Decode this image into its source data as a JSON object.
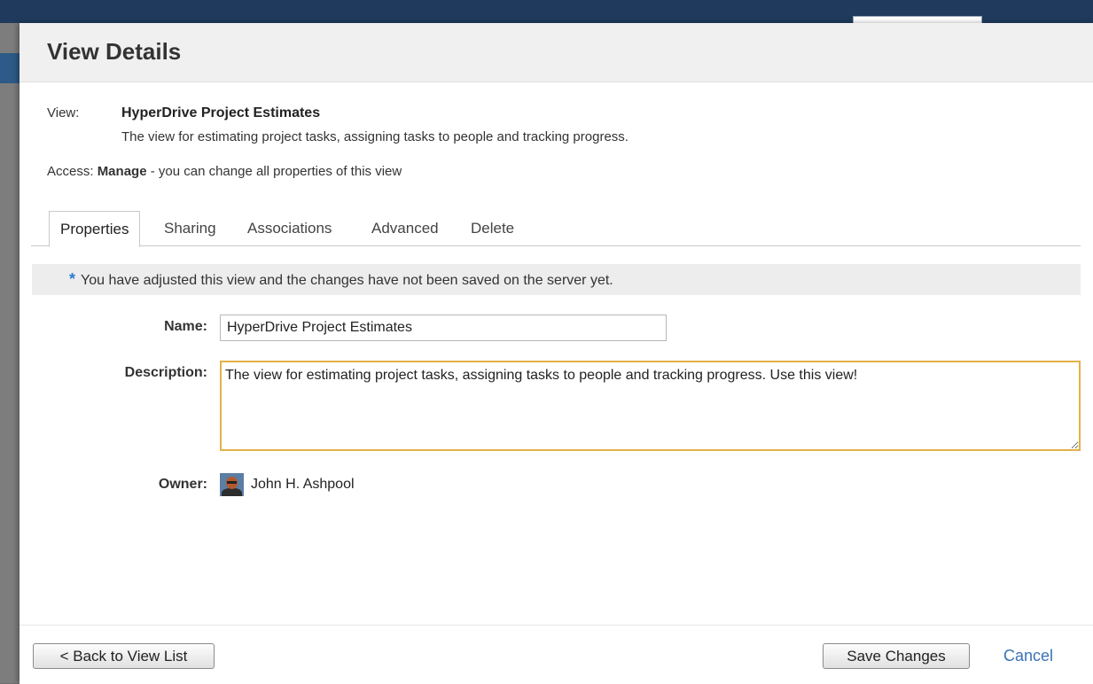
{
  "dialog": {
    "title": "View Details"
  },
  "view": {
    "label": "View:",
    "name": "HyperDrive Project Estimates",
    "description": "The view for estimating project tasks, assigning tasks to people and tracking progress."
  },
  "access": {
    "label": "Access:",
    "level": "Manage",
    "text": " - you can change all properties of this view"
  },
  "tabs": [
    {
      "label": "Properties",
      "active": true
    },
    {
      "label": "Sharing",
      "active": false
    },
    {
      "label": "Associations",
      "active": false
    },
    {
      "label": "Advanced",
      "active": false
    },
    {
      "label": "Delete",
      "active": false
    }
  ],
  "notice": {
    "marker": "*",
    "text": "You have adjusted this view and the changes have not been saved on the server yet."
  },
  "form": {
    "name_label": "Name:",
    "name_value": "HyperDrive Project Estimates",
    "description_label": "Description:",
    "description_value": "The view for estimating project tasks, assigning tasks to people and tracking progress. Use this view!",
    "owner_label": "Owner:",
    "owner_name": "John H. Ashpool"
  },
  "footer": {
    "back_label": "< Back to View List",
    "save_label": "Save Changes",
    "cancel_label": "Cancel"
  },
  "colors": {
    "accent_link": "#3a72b5",
    "notice_marker": "#2b7bd0",
    "focus_border": "#e2b14a"
  }
}
